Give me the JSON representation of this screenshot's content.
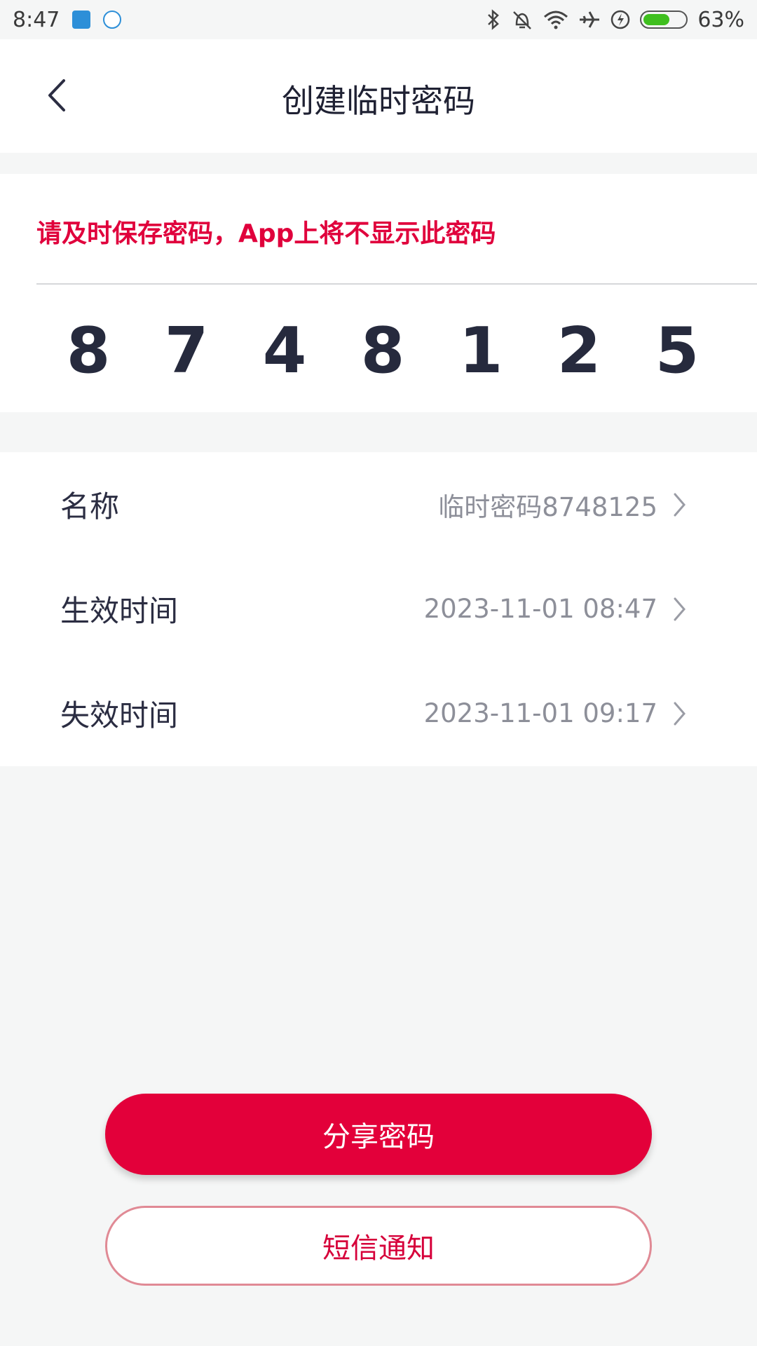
{
  "status_bar": {
    "time": "8:47",
    "battery_percent_label": "63%",
    "battery_level": 0.63,
    "icons": [
      "app-notification-icon",
      "iflytek-icon",
      "bluetooth-icon",
      "alarm-off-icon",
      "wifi-icon",
      "airplane-icon",
      "charging-icon",
      "battery-icon"
    ]
  },
  "header": {
    "title": "创建临时密码",
    "back_icon": "chevron-left-icon"
  },
  "password_card": {
    "warning": "请及时保存密码，App上将不显示此密码",
    "digits": [
      "8",
      "7",
      "4",
      "8",
      "1",
      "2",
      "5"
    ]
  },
  "info_rows": [
    {
      "label": "名称",
      "value": "临时密码8748125"
    },
    {
      "label": "生效时间",
      "value": "2023-11-01 08:47"
    },
    {
      "label": "失效时间",
      "value": "2023-11-01 09:17"
    }
  ],
  "buttons": {
    "share_label": "分享密码",
    "sms_label": "短信通知"
  },
  "colors": {
    "accent": "#e3003a",
    "warning_text": "#e0003c",
    "background": "#f5f6f6"
  }
}
